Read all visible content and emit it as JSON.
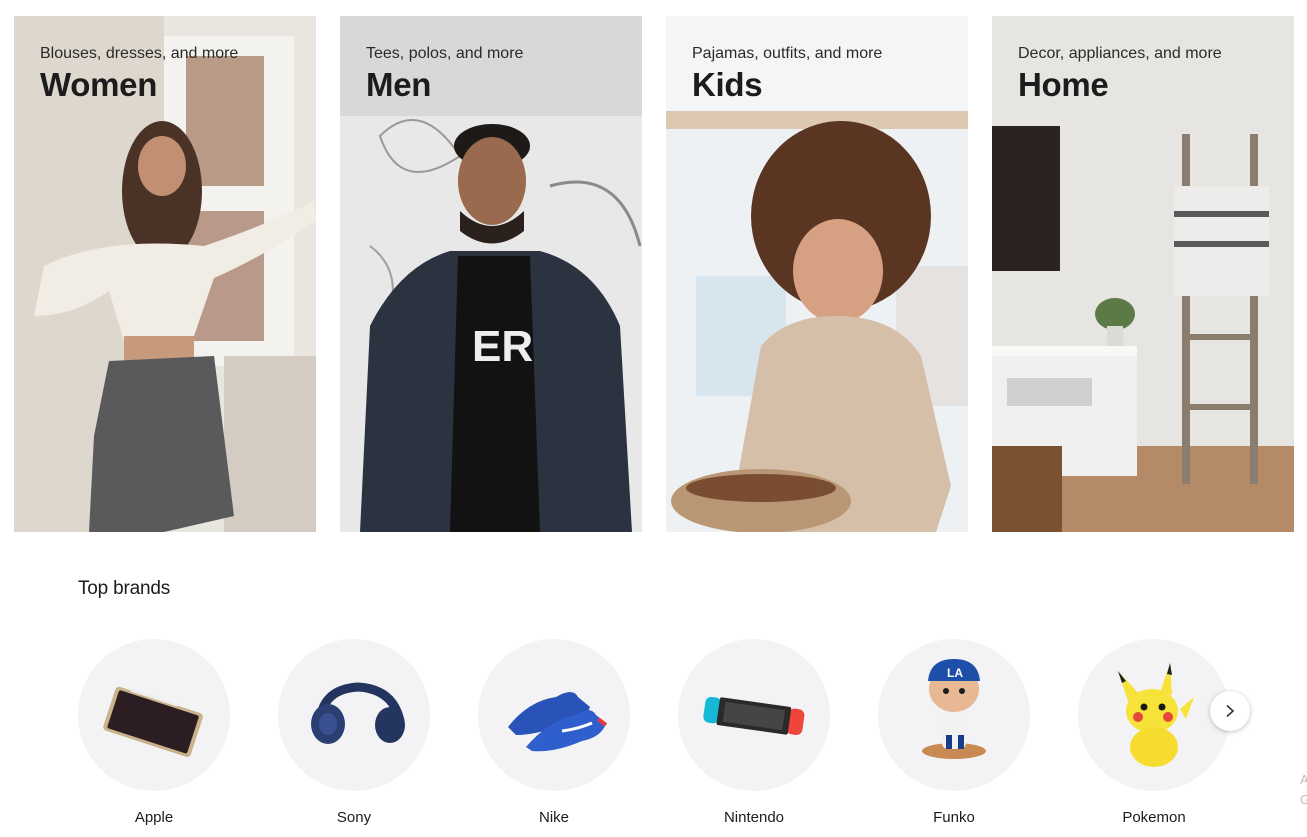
{
  "categories": [
    {
      "id": "women",
      "subtitle": "Blouses, dresses, and more",
      "title": "Women"
    },
    {
      "id": "men",
      "subtitle": "Tees, polos, and more",
      "title": "Men"
    },
    {
      "id": "kids",
      "subtitle": "Pajamas, outfits, and more",
      "title": "Kids"
    },
    {
      "id": "home",
      "subtitle": "Decor, appliances, and more",
      "title": "Home"
    }
  ],
  "brands": {
    "heading": "Top brands",
    "items": [
      {
        "label": "Apple",
        "icon": "tablet-icon"
      },
      {
        "label": "Sony",
        "icon": "headphones-icon"
      },
      {
        "label": "Nike",
        "icon": "sneakers-icon"
      },
      {
        "label": "Nintendo",
        "icon": "game-console-icon"
      },
      {
        "label": "Funko",
        "icon": "figure-icon"
      },
      {
        "label": "Pokemon",
        "icon": "pikachu-icon"
      }
    ],
    "next_icon": "chevron-right-icon"
  },
  "edge_fragment": {
    "line1": "A",
    "line2": "G"
  }
}
